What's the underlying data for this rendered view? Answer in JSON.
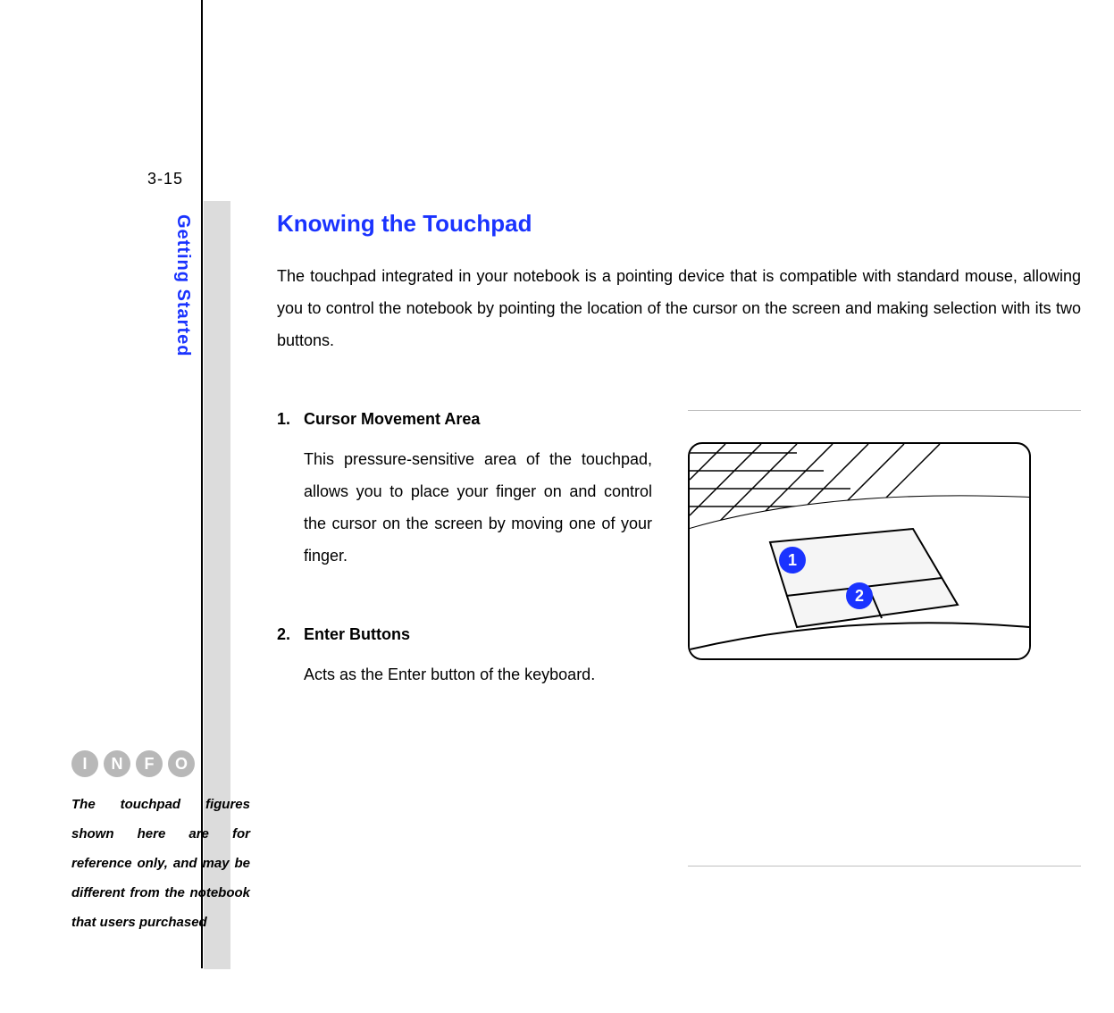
{
  "page_number": "3-15",
  "section_tab": "Getting Started",
  "title": "Knowing the Touchpad",
  "intro": "The touchpad integrated in your notebook is a pointing device that is compatible with standard mouse, allowing you to control the notebook by pointing the location of the cursor on the screen and making selection with its two buttons.",
  "items": [
    {
      "num": "1.",
      "head": "Cursor Movement Area",
      "body": "This pressure-sensitive area of the touchpad, allows you to place your finger on and control the cursor on the screen by moving one of your finger."
    },
    {
      "num": "2.",
      "head": "Enter Buttons",
      "body": "Acts as the Enter button of the keyboard."
    }
  ],
  "callouts": [
    "1",
    "2"
  ],
  "info_glyphs": [
    "I",
    "N",
    "F",
    "O"
  ],
  "info_note": "The touchpad figures shown here are for reference only, and may be different from the notebook that users purchased"
}
